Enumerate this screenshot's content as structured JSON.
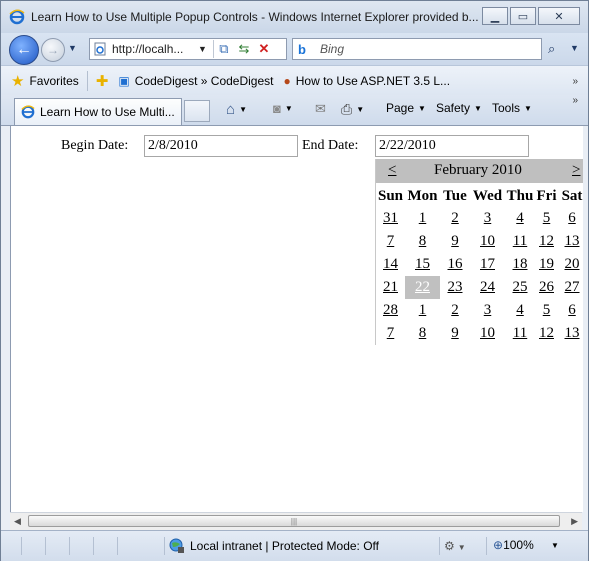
{
  "window": {
    "title": "Learn How to Use Multiple Popup Controls - Windows Internet Explorer provided b...",
    "minimize_icon": "minimize-icon",
    "maximize_icon": "maximize-icon",
    "close_icon": "close-icon"
  },
  "address_bar": {
    "url": "http://localh...",
    "search_placeholder": "Bing"
  },
  "favorites_bar": {
    "favorites_label": "Favorites",
    "links": [
      {
        "label": "CodeDigest » CodeDigest",
        "icon": "page-icon"
      },
      {
        "label": "How to Use ASP.NET 3.5 L...",
        "icon": "bean-icon"
      }
    ]
  },
  "tabs": {
    "active_label": "Learn How to Use Multi..."
  },
  "commands": {
    "page": "Page",
    "safety": "Safety",
    "tools": "Tools"
  },
  "form": {
    "begin_label": "Begin Date:",
    "begin_value": "2/8/2010",
    "end_label": "End Date:",
    "end_value": "2/22/2010"
  },
  "calendar": {
    "prev": "<",
    "next": ">",
    "title": "February 2010",
    "day_headers": [
      "Sun",
      "Mon",
      "Tue",
      "Wed",
      "Thu",
      "Fri",
      "Sat"
    ],
    "weeks": [
      [
        "31",
        "1",
        "2",
        "3",
        "4",
        "5",
        "6"
      ],
      [
        "7",
        "8",
        "9",
        "10",
        "11",
        "12",
        "13"
      ],
      [
        "14",
        "15",
        "16",
        "17",
        "18",
        "19",
        "20"
      ],
      [
        "21",
        "22",
        "23",
        "24",
        "25",
        "26",
        "27"
      ],
      [
        "28",
        "1",
        "2",
        "3",
        "4",
        "5",
        "6"
      ],
      [
        "7",
        "8",
        "9",
        "10",
        "11",
        "12",
        "13"
      ]
    ],
    "selected": "22"
  },
  "status_bar": {
    "zone": "Local intranet | Protected Mode: Off",
    "zoom": "100%"
  }
}
